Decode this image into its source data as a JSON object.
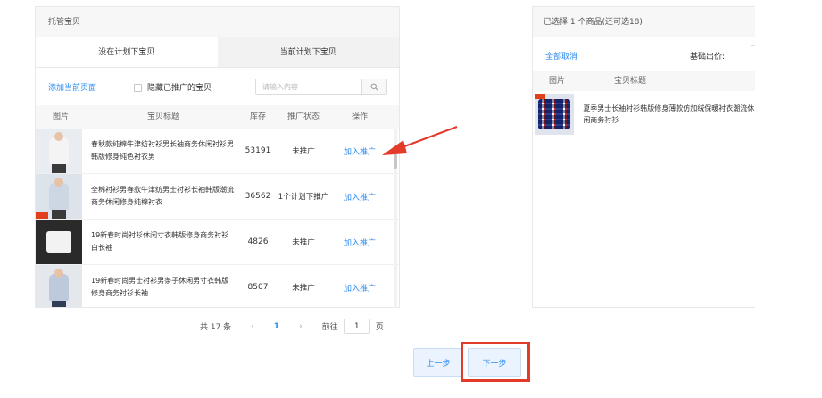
{
  "left_panel": {
    "title": "托管宝贝",
    "tabs": [
      {
        "label": "没在计划下宝贝"
      },
      {
        "label": "当前计划下宝贝"
      }
    ],
    "toolbar": {
      "add_page_link": "添加当前页面",
      "hide_promoted_label": "隐藏已推广的宝贝",
      "search_placeholder": "请输入内容"
    },
    "columns": {
      "image": "图片",
      "title": "宝贝标题",
      "stock": "库存",
      "status": "推广状态",
      "action": "操作"
    },
    "rows": [
      {
        "title": "春秋款纯棉牛津纺衬衫男长袖商务休闲衬衫男韩版修身纯色衬衣男",
        "stock": "53191",
        "status": "未推广",
        "action": "加入推广",
        "shirt_color": "#f4f4f4"
      },
      {
        "title": "全棉衬衫男春款牛津纺男士衬衫长袖韩版潮流商务休闲修身纯棉衬衣",
        "stock": "36562",
        "status": "1个计划下推广",
        "action": "加入推广",
        "shirt_color": "#cdd7e4"
      },
      {
        "title": "19新春时尚衬衫休闲寸衣韩版修身商务衬衫白长袖",
        "stock": "4826",
        "status": "未推广",
        "action": "加入推广",
        "shirt_color": "#f2f2f2"
      },
      {
        "title": "19新春时尚男士衬衫男条子休闲男寸衣韩版修身商务衬衫长袖",
        "stock": "8507",
        "status": "未推广",
        "action": "加入推广",
        "shirt_color": "#bccadc"
      }
    ],
    "pagination": {
      "total": "共 17 条",
      "prev": "‹",
      "current": "1",
      "next": "›",
      "goto_label": "前往",
      "goto_value": "1",
      "page_unit": "页"
    }
  },
  "right_panel": {
    "title": "已选择 1 个商品(还可选18)",
    "cancel_all": "全部取消",
    "price_label": "基础出价:",
    "columns": {
      "image": "图片",
      "title": "宝贝标题"
    },
    "rows": [
      {
        "title": "夏季男士长袖衬衫韩版修身薄款仿加绒保暖衬衣潮流休闲商务衬衫"
      }
    ]
  },
  "buttons": {
    "prev": "上一步",
    "next": "下一步"
  },
  "colors": {
    "accent": "#2d8cf0",
    "highlight": "#e33a2a"
  }
}
